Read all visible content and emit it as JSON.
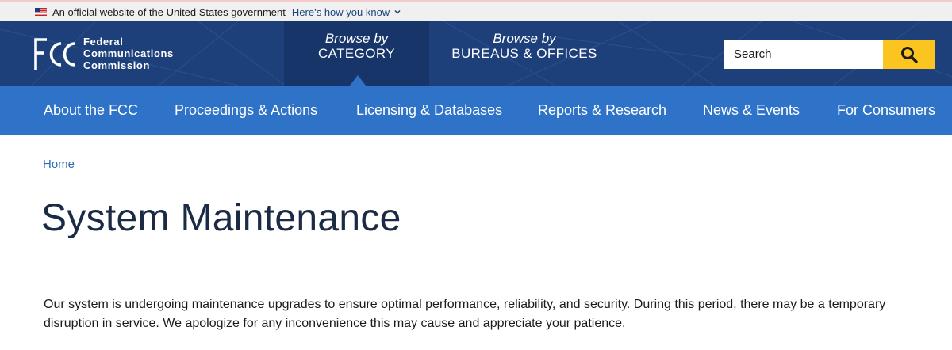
{
  "gov_banner": {
    "text": "An official website of the United States government",
    "link": "Here’s how you know"
  },
  "header": {
    "logo": {
      "mark": "FCC",
      "line1": "Federal",
      "line2": "Communications",
      "line3": "Commission"
    },
    "browse_category": {
      "small": "Browse by",
      "big": "CATEGORY"
    },
    "browse_bureaus": {
      "small": "Browse by",
      "big": "BUREAUS & OFFICES"
    },
    "search": {
      "placeholder": "Search"
    }
  },
  "nav": {
    "items": [
      {
        "label": "About the FCC"
      },
      {
        "label": "Proceedings & Actions"
      },
      {
        "label": "Licensing & Databases"
      },
      {
        "label": "Reports & Research"
      },
      {
        "label": "News & Events"
      },
      {
        "label": "For Consumers"
      }
    ]
  },
  "breadcrumb": {
    "home": "Home"
  },
  "page": {
    "title": "System Maintenance",
    "body": "Our system is undergoing maintenance upgrades to ensure optimal performance, reliability, and security. During this period, there may be a temporary disruption in service. We apologize for any inconvenience this may cause and appreciate your patience."
  },
  "colors": {
    "header_bg": "#1d3f7a",
    "nav_bg": "#2f73c9",
    "search_button": "#fbc41e",
    "link": "#2a6bb8"
  },
  "icons": {
    "flag": "us-flag-icon",
    "chevron": "chevron-down-icon",
    "search": "search-icon"
  }
}
